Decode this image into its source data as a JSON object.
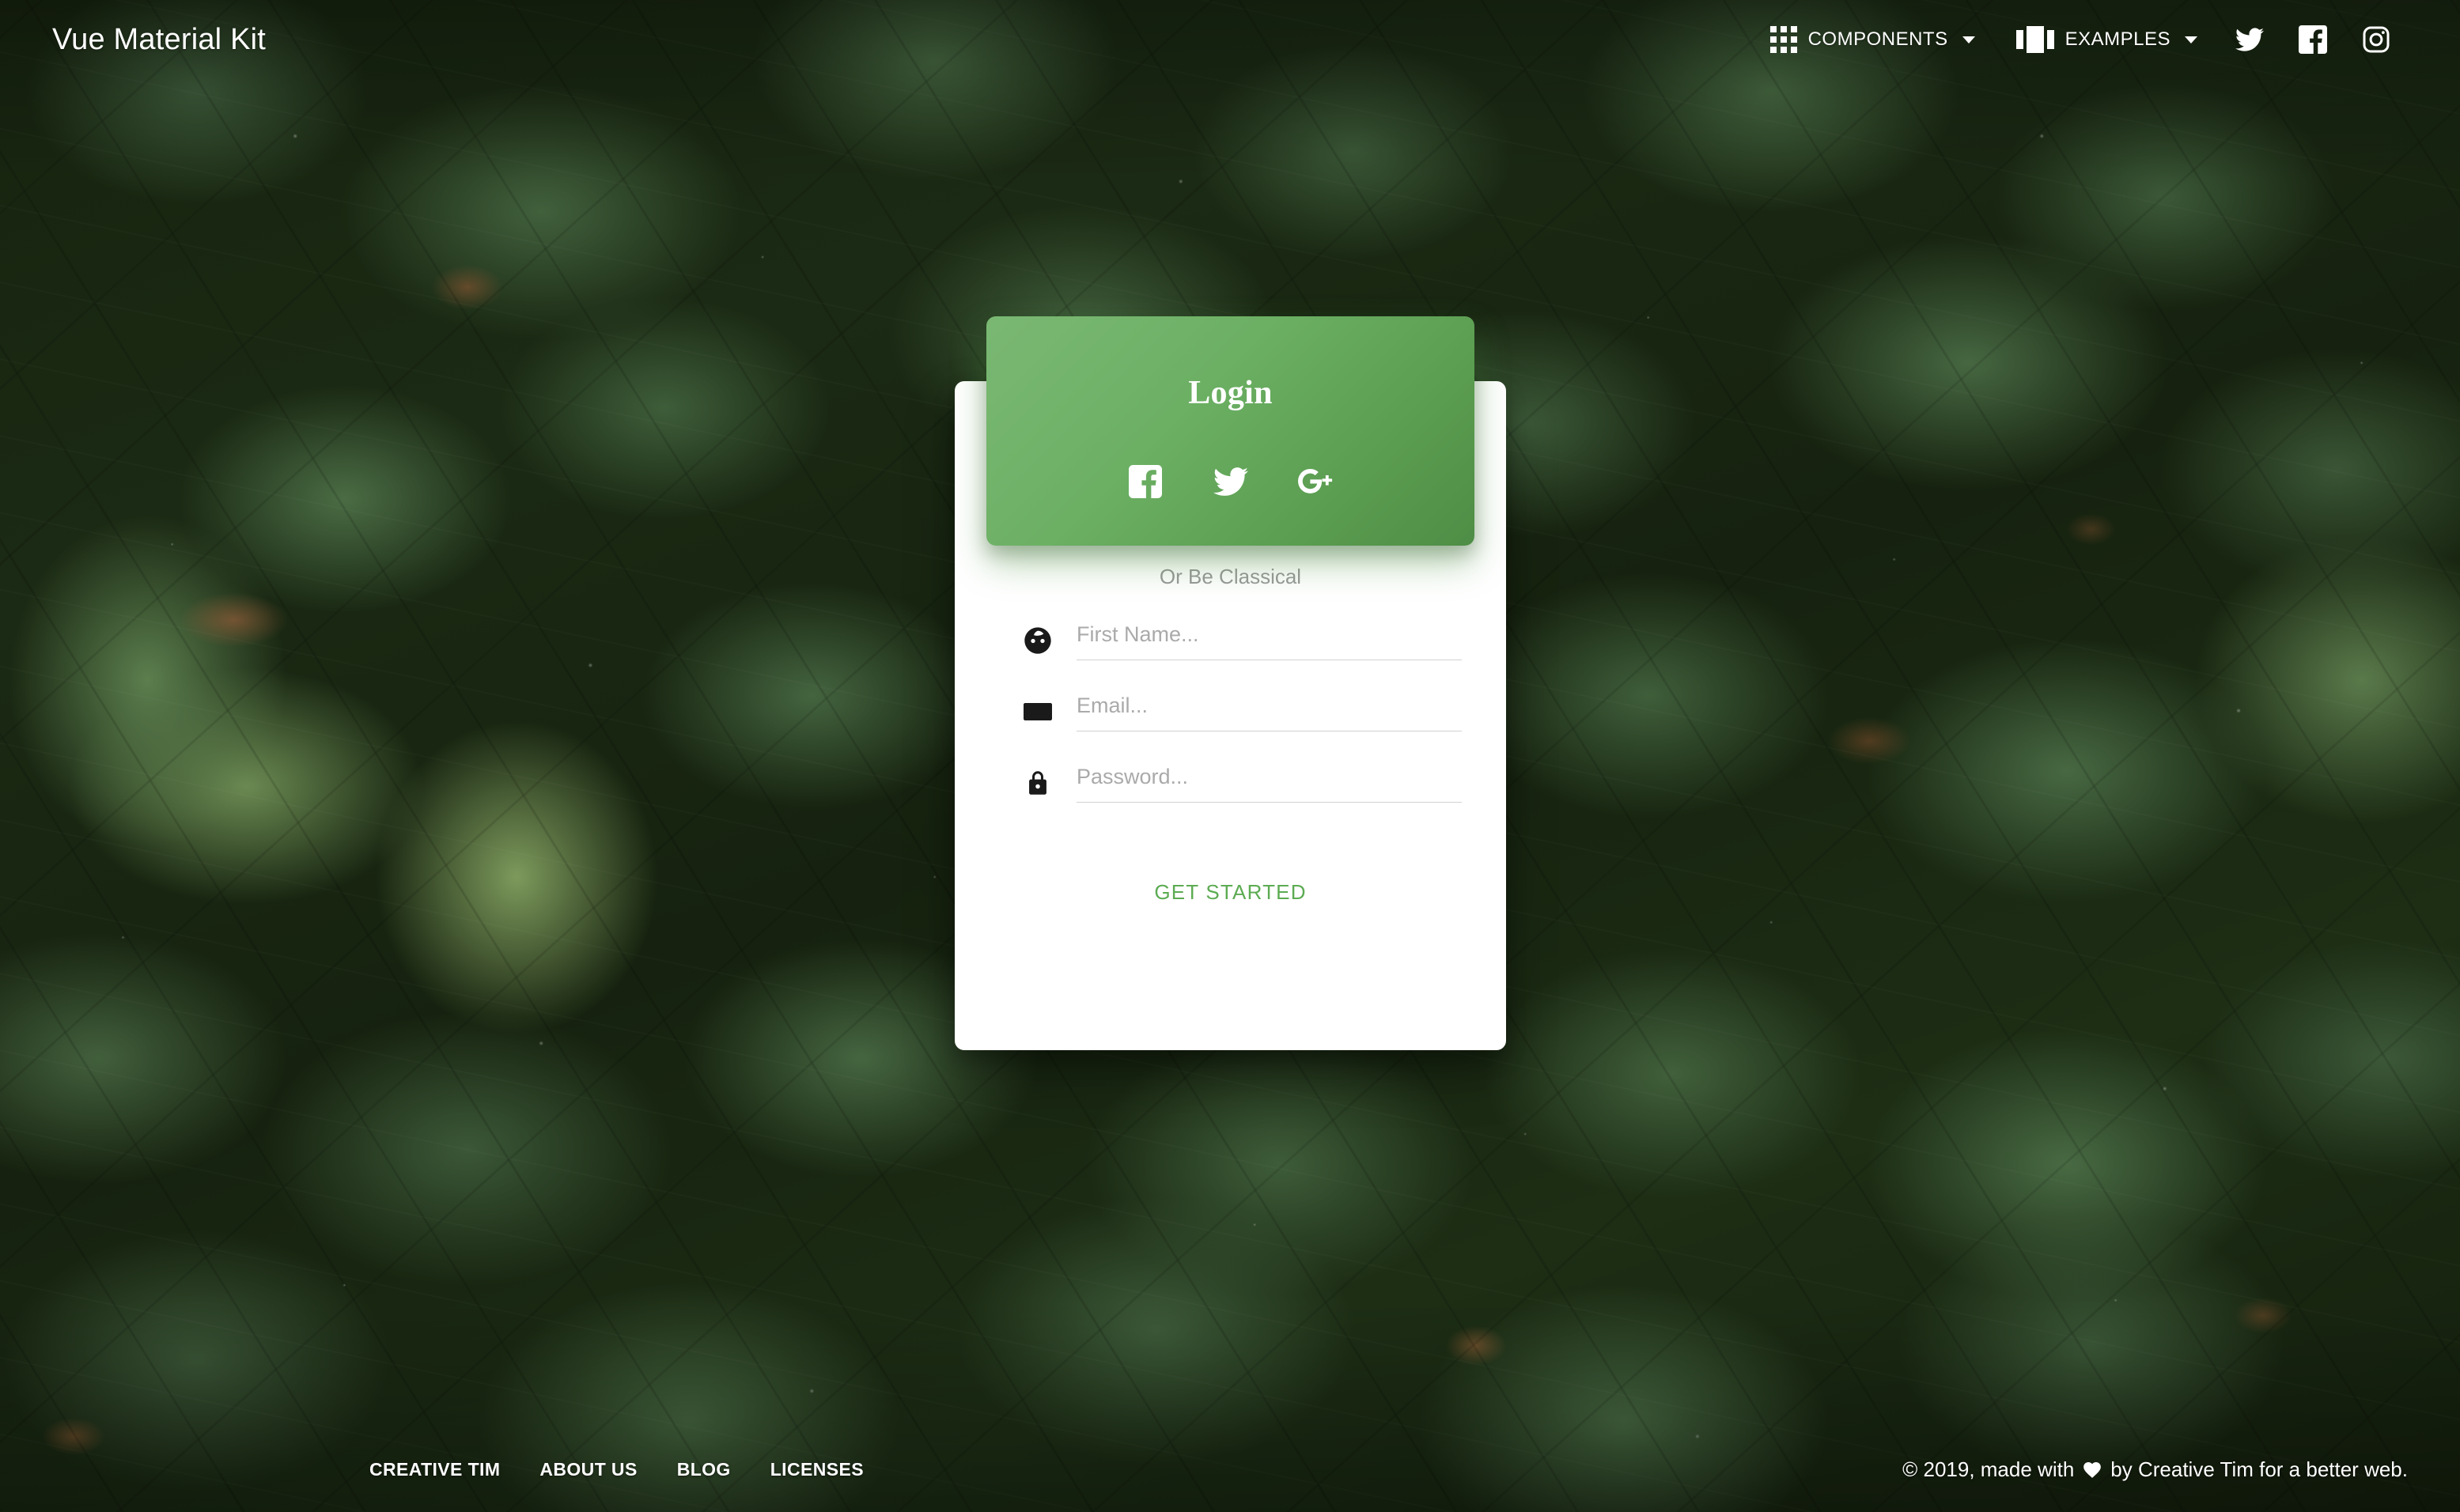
{
  "navbar": {
    "brand": "Vue Material Kit",
    "items": [
      {
        "label": "COMPONENTS",
        "icon": "apps-grid-icon",
        "has_caret": true
      },
      {
        "label": "EXAMPLES",
        "icon": "view-carousel-icon",
        "has_caret": true
      }
    ],
    "social": [
      {
        "name": "twitter-icon"
      },
      {
        "name": "facebook-icon"
      },
      {
        "name": "instagram-icon"
      }
    ]
  },
  "login_card": {
    "title": "Login",
    "social_logins": [
      {
        "name": "facebook-icon",
        "label": "Facebook"
      },
      {
        "name": "twitter-icon",
        "label": "Twitter"
      },
      {
        "name": "google-plus-icon",
        "label": "Google Plus"
      }
    ],
    "divider_text": "Or Be Classical",
    "fields": [
      {
        "icon": "face-icon",
        "placeholder": "First Name...",
        "value": "",
        "type": "text"
      },
      {
        "icon": "email-icon",
        "placeholder": "Email...",
        "value": "",
        "type": "text"
      },
      {
        "icon": "lock-icon",
        "placeholder": "Password...",
        "value": "",
        "type": "password"
      }
    ],
    "submit_label": "GET STARTED"
  },
  "footer": {
    "links": [
      "CREATIVE TIM",
      "ABOUT US",
      "BLOG",
      "LICENSES"
    ],
    "copyright_prefix": "© 2019, made with",
    "copyright_suffix": "by Creative Tim for a better web.",
    "heart_icon": "heart-icon"
  },
  "colors": {
    "brand_green": "#5cab52",
    "header_green_light": "#7ab873",
    "header_green_dark": "#4e8d45",
    "card_background": "#ffffff",
    "placeholder_gray": "#aaaaaa",
    "divider_gray": "#999999"
  }
}
